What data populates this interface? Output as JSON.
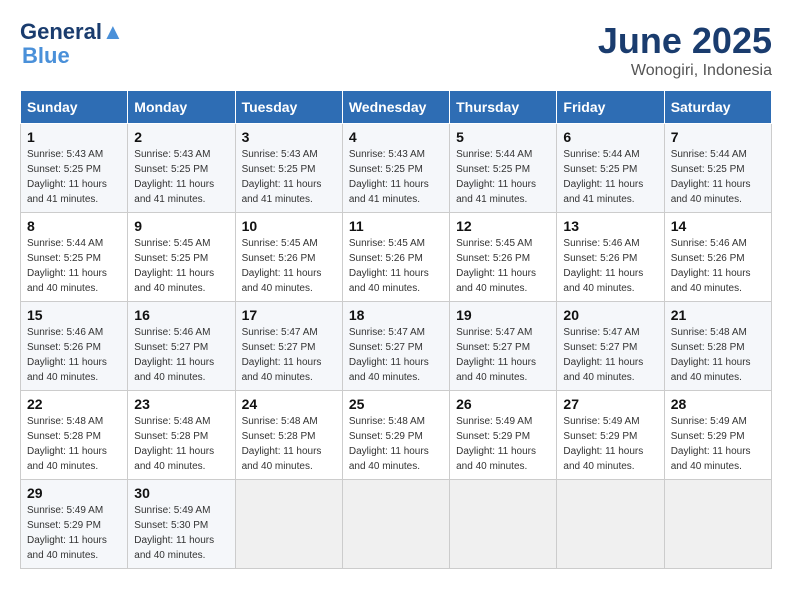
{
  "header": {
    "logo_line1": "General",
    "logo_line2": "Blue",
    "month": "June 2025",
    "location": "Wonogiri, Indonesia"
  },
  "columns": [
    "Sunday",
    "Monday",
    "Tuesday",
    "Wednesday",
    "Thursday",
    "Friday",
    "Saturday"
  ],
  "weeks": [
    [
      {
        "day": "1",
        "sunrise": "5:43 AM",
        "sunset": "5:25 PM",
        "daylight": "11 hours and 41 minutes."
      },
      {
        "day": "2",
        "sunrise": "5:43 AM",
        "sunset": "5:25 PM",
        "daylight": "11 hours and 41 minutes."
      },
      {
        "day": "3",
        "sunrise": "5:43 AM",
        "sunset": "5:25 PM",
        "daylight": "11 hours and 41 minutes."
      },
      {
        "day": "4",
        "sunrise": "5:43 AM",
        "sunset": "5:25 PM",
        "daylight": "11 hours and 41 minutes."
      },
      {
        "day": "5",
        "sunrise": "5:44 AM",
        "sunset": "5:25 PM",
        "daylight": "11 hours and 41 minutes."
      },
      {
        "day": "6",
        "sunrise": "5:44 AM",
        "sunset": "5:25 PM",
        "daylight": "11 hours and 41 minutes."
      },
      {
        "day": "7",
        "sunrise": "5:44 AM",
        "sunset": "5:25 PM",
        "daylight": "11 hours and 40 minutes."
      }
    ],
    [
      {
        "day": "8",
        "sunrise": "5:44 AM",
        "sunset": "5:25 PM",
        "daylight": "11 hours and 40 minutes."
      },
      {
        "day": "9",
        "sunrise": "5:45 AM",
        "sunset": "5:25 PM",
        "daylight": "11 hours and 40 minutes."
      },
      {
        "day": "10",
        "sunrise": "5:45 AM",
        "sunset": "5:26 PM",
        "daylight": "11 hours and 40 minutes."
      },
      {
        "day": "11",
        "sunrise": "5:45 AM",
        "sunset": "5:26 PM",
        "daylight": "11 hours and 40 minutes."
      },
      {
        "day": "12",
        "sunrise": "5:45 AM",
        "sunset": "5:26 PM",
        "daylight": "11 hours and 40 minutes."
      },
      {
        "day": "13",
        "sunrise": "5:46 AM",
        "sunset": "5:26 PM",
        "daylight": "11 hours and 40 minutes."
      },
      {
        "day": "14",
        "sunrise": "5:46 AM",
        "sunset": "5:26 PM",
        "daylight": "11 hours and 40 minutes."
      }
    ],
    [
      {
        "day": "15",
        "sunrise": "5:46 AM",
        "sunset": "5:26 PM",
        "daylight": "11 hours and 40 minutes."
      },
      {
        "day": "16",
        "sunrise": "5:46 AM",
        "sunset": "5:27 PM",
        "daylight": "11 hours and 40 minutes."
      },
      {
        "day": "17",
        "sunrise": "5:47 AM",
        "sunset": "5:27 PM",
        "daylight": "11 hours and 40 minutes."
      },
      {
        "day": "18",
        "sunrise": "5:47 AM",
        "sunset": "5:27 PM",
        "daylight": "11 hours and 40 minutes."
      },
      {
        "day": "19",
        "sunrise": "5:47 AM",
        "sunset": "5:27 PM",
        "daylight": "11 hours and 40 minutes."
      },
      {
        "day": "20",
        "sunrise": "5:47 AM",
        "sunset": "5:27 PM",
        "daylight": "11 hours and 40 minutes."
      },
      {
        "day": "21",
        "sunrise": "5:48 AM",
        "sunset": "5:28 PM",
        "daylight": "11 hours and 40 minutes."
      }
    ],
    [
      {
        "day": "22",
        "sunrise": "5:48 AM",
        "sunset": "5:28 PM",
        "daylight": "11 hours and 40 minutes."
      },
      {
        "day": "23",
        "sunrise": "5:48 AM",
        "sunset": "5:28 PM",
        "daylight": "11 hours and 40 minutes."
      },
      {
        "day": "24",
        "sunrise": "5:48 AM",
        "sunset": "5:28 PM",
        "daylight": "11 hours and 40 minutes."
      },
      {
        "day": "25",
        "sunrise": "5:48 AM",
        "sunset": "5:29 PM",
        "daylight": "11 hours and 40 minutes."
      },
      {
        "day": "26",
        "sunrise": "5:49 AM",
        "sunset": "5:29 PM",
        "daylight": "11 hours and 40 minutes."
      },
      {
        "day": "27",
        "sunrise": "5:49 AM",
        "sunset": "5:29 PM",
        "daylight": "11 hours and 40 minutes."
      },
      {
        "day": "28",
        "sunrise": "5:49 AM",
        "sunset": "5:29 PM",
        "daylight": "11 hours and 40 minutes."
      }
    ],
    [
      {
        "day": "29",
        "sunrise": "5:49 AM",
        "sunset": "5:29 PM",
        "daylight": "11 hours and 40 minutes."
      },
      {
        "day": "30",
        "sunrise": "5:49 AM",
        "sunset": "5:30 PM",
        "daylight": "11 hours and 40 minutes."
      },
      null,
      null,
      null,
      null,
      null
    ]
  ],
  "labels": {
    "sunrise": "Sunrise:",
    "sunset": "Sunset:",
    "daylight": "Daylight:"
  }
}
